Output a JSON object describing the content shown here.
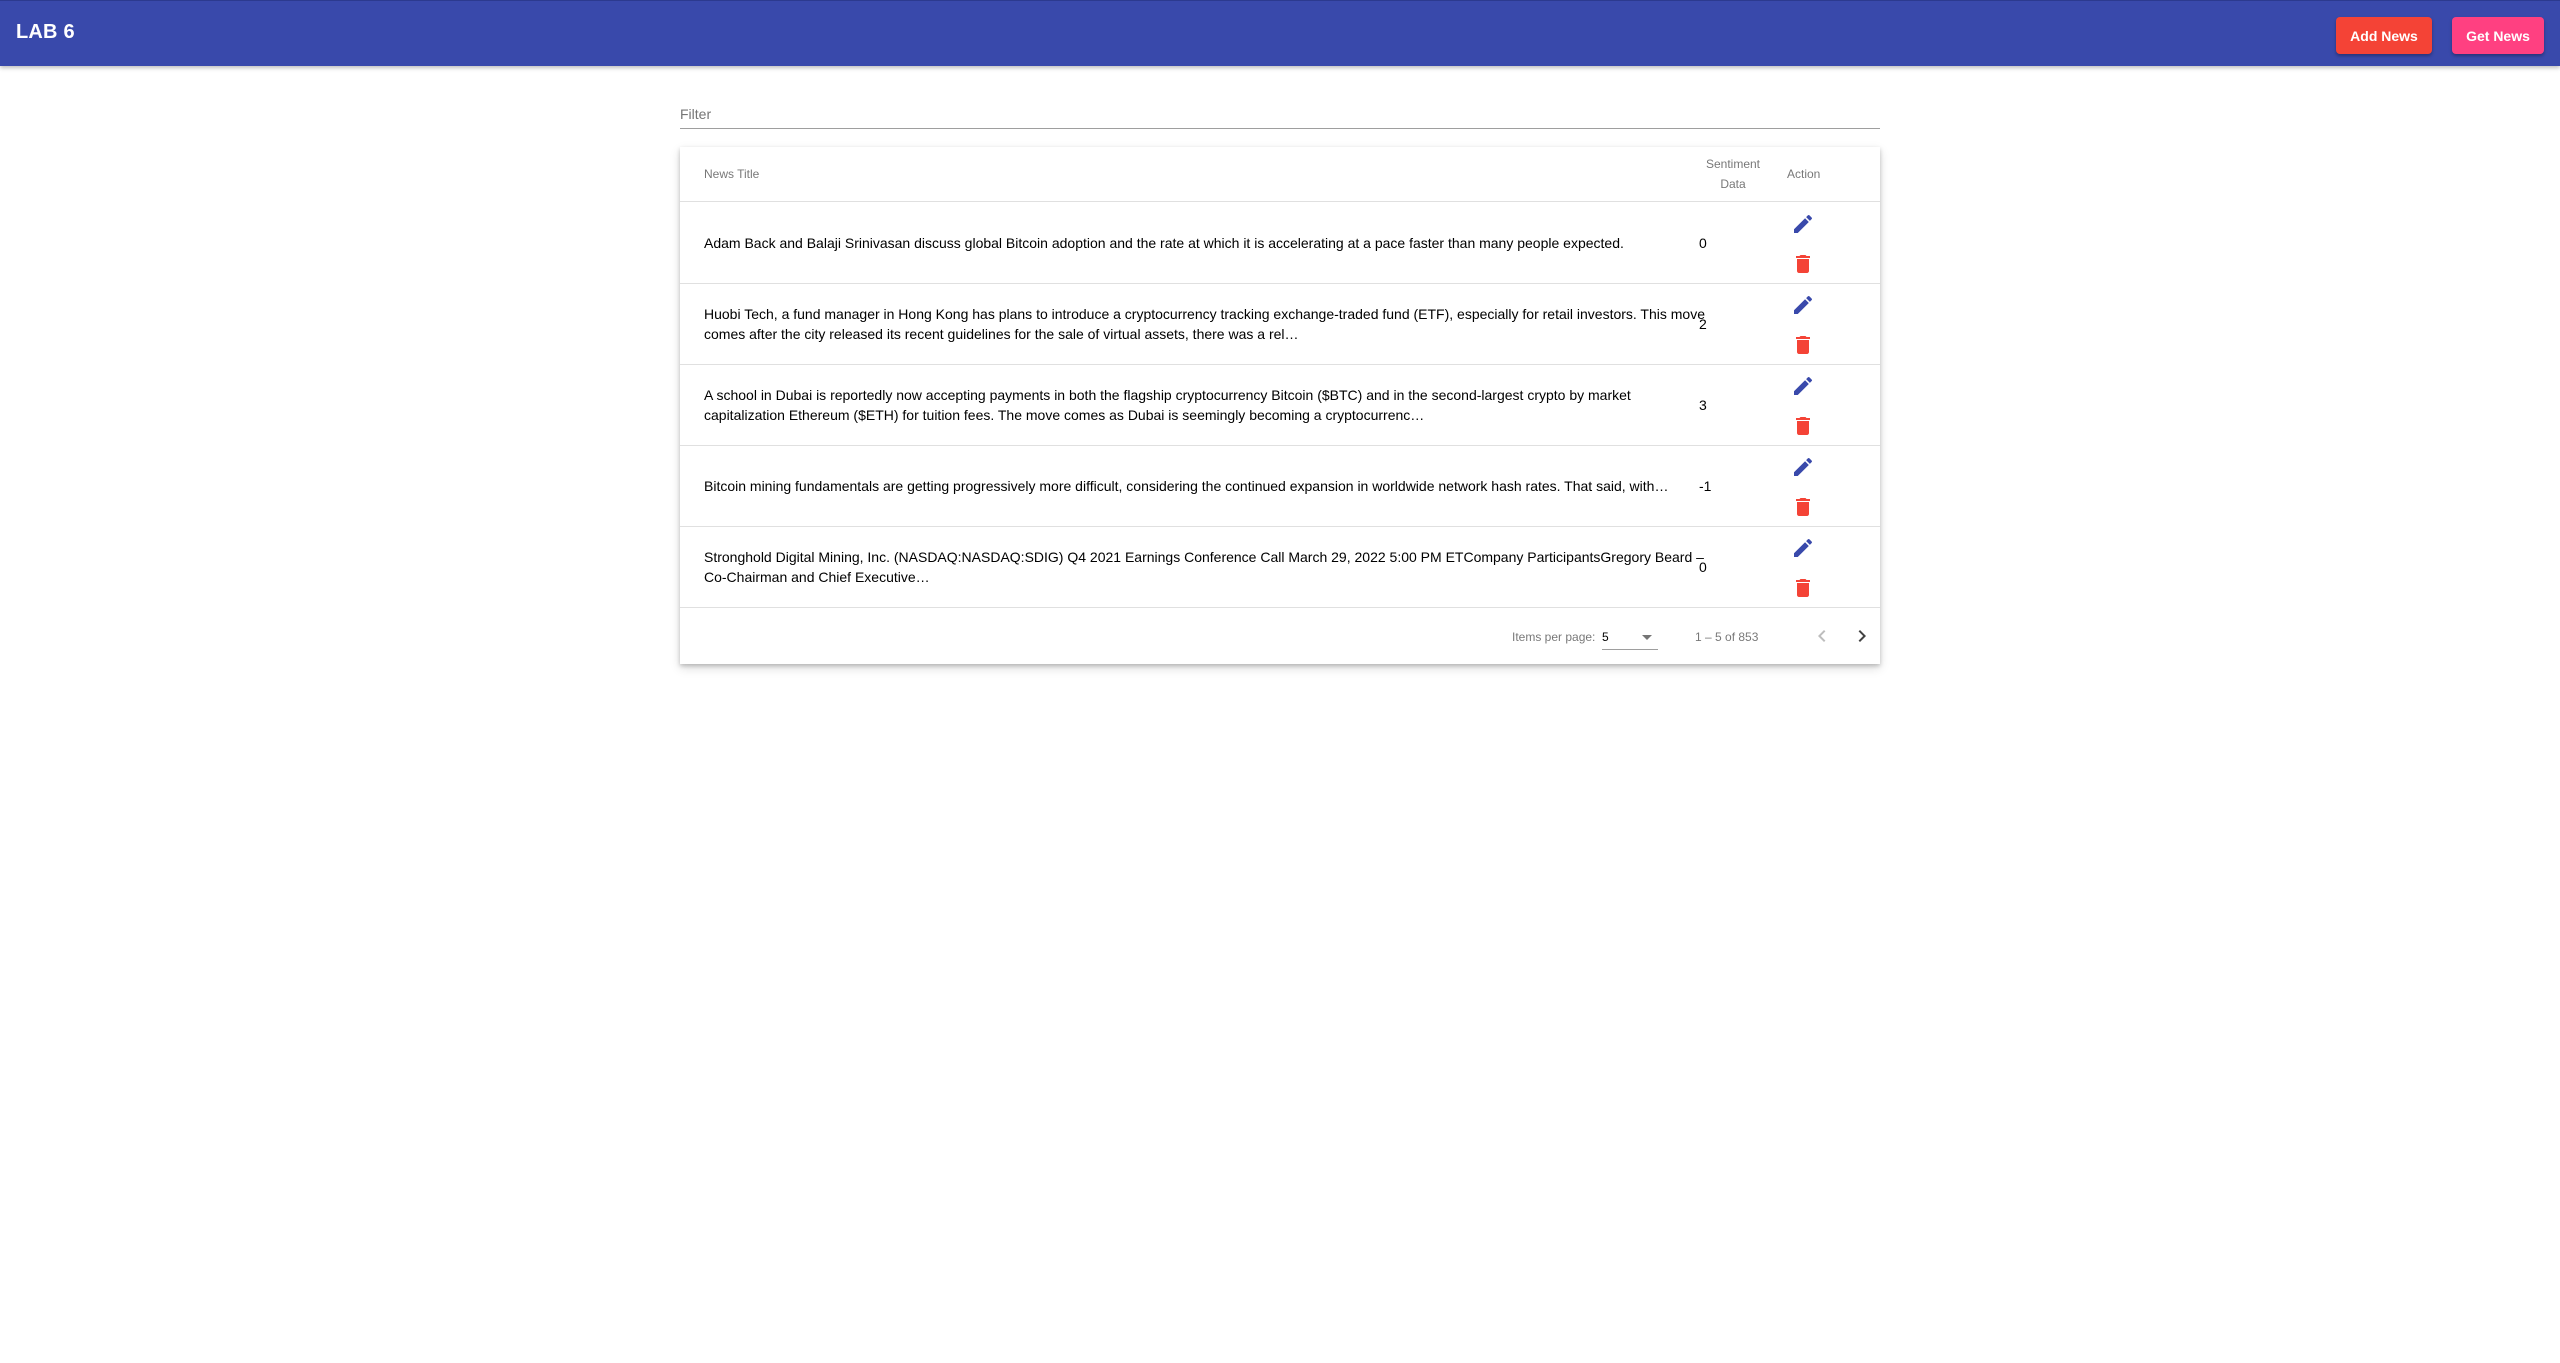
{
  "app": {
    "title": "LAB 6"
  },
  "toolbar": {
    "add_label": "Add News",
    "get_label": "Get News"
  },
  "filter": {
    "placeholder": "Filter",
    "value": ""
  },
  "table": {
    "headers": {
      "title": "News Title",
      "sentiment": [
        "Sentiment",
        "Data"
      ],
      "action": "Action"
    },
    "rows": [
      {
        "lines": [
          "Adam Back and Balaji Srinivasan discuss global Bitcoin adoption and the rate at which it is accelerating at a pace faster than many people expected."
        ],
        "sentiment": "0"
      },
      {
        "lines": [
          "Huobi Tech, a fund manager in Hong Kong has plans to introduce a cryptocurrency tracking exchange-traded fund (ETF), especially for retail investors. This move",
          "comes after the city released its recent guidelines for the sale of virtual assets, there was a rel…"
        ],
        "sentiment": "2"
      },
      {
        "lines": [
          "A school in Dubai is reportedly now accepting payments in both the flagship cryptocurrency Bitcoin ($BTC) and in the second-largest crypto by market",
          "capitalization Ethereum ($ETH) for tuition fees. The move comes as Dubai is seemingly becoming a cryptocurrenc…"
        ],
        "sentiment": "3"
      },
      {
        "lines": [
          "Bitcoin mining fundamentals are getting progressively more difficult, considering the continued expansion in worldwide network hash rates. That said, with…"
        ],
        "sentiment": "-1"
      },
      {
        "lines": [
          "Stronghold Digital Mining, Inc. (NASDAQ:NASDAQ:SDIG) Q4 2021 Earnings Conference Call March 29, 2022 5:00 PM ETCompany ParticipantsGregory Beard –",
          "Co-Chairman and Chief Executive…"
        ],
        "sentiment": "0"
      }
    ],
    "row_actions": {
      "edit_icon": "pencil-icon",
      "delete_icon": "trash-icon"
    }
  },
  "paginator": {
    "label": "Items per page:",
    "page_size": "5",
    "range": "1 – 5 of 853",
    "prev_icon": "chevron-left-icon",
    "next_icon": "chevron-right-icon"
  },
  "colors": {
    "primary": "#3949ab",
    "warn": "#f44336",
    "accent": "#ff4081"
  }
}
